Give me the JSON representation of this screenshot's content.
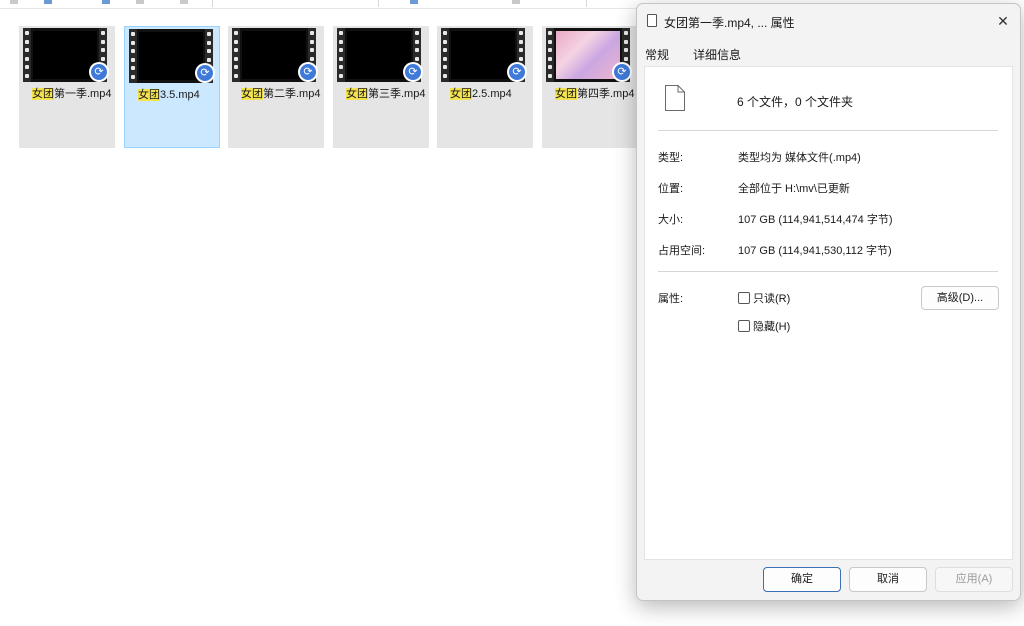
{
  "files": [
    {
      "highlight": "女团",
      "rest": "第一季.mp4",
      "thumb": "black",
      "selected": false
    },
    {
      "highlight": "女团",
      "rest": "3.5.mp4",
      "thumb": "black",
      "selected": true
    },
    {
      "highlight": "女团",
      "rest": "第二季.mp4",
      "thumb": "black",
      "selected": false
    },
    {
      "highlight": "女团",
      "rest": "第三季.mp4",
      "thumb": "black",
      "selected": false
    },
    {
      "highlight": "女团",
      "rest": "2.5.mp4",
      "thumb": "black",
      "selected": false
    },
    {
      "highlight": "女团",
      "rest": "第四季.mp4",
      "thumb": "pink",
      "selected": false
    }
  ],
  "dialog": {
    "title": "女团第一季.mp4, ... 属性",
    "close_glyph": "✕",
    "tabs": [
      "常规",
      "详细信息"
    ],
    "summary": "6 个文件，0 个文件夹",
    "rows": [
      {
        "label": "类型:",
        "value": "类型均为 媒体文件(.mp4)"
      },
      {
        "label": "位置:",
        "value": "全部位于 H:\\mv\\已更新"
      },
      {
        "label": "大小:",
        "value": "107 GB (114,941,514,474 字节)"
      },
      {
        "label": "占用空间:",
        "value": "107 GB (114,941,530,112 字节)"
      }
    ],
    "attributes_label": "属性:",
    "readonly_label": "只读(R)",
    "hidden_label": "隐藏(H)",
    "advanced_label": "高级(D)...",
    "ok_label": "确定",
    "cancel_label": "取消",
    "apply_label": "应用(A)"
  },
  "icons": {
    "sync": "sync-arrow-icon",
    "file": "document-icon",
    "close": "close-icon"
  },
  "colors": {
    "selection": "#cce8ff",
    "highlight": "#f4e34f",
    "sync_badge": "#3f7ad9",
    "ok_border": "#3b6fb6"
  }
}
